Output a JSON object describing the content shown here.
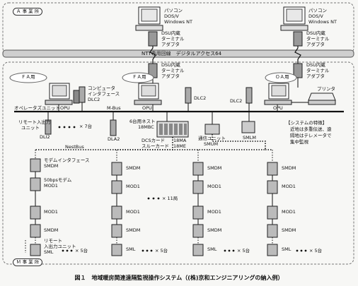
{
  "sites": {
    "a_office": "Ａ 事 業 所",
    "m_office": "Ｍ 事 業 所",
    "fa1": "ＦＡ用",
    "fa2": "ＦＡ用",
    "oa": "ＯＡ用"
  },
  "pc_labels": {
    "pc1": [
      "パソコン",
      "DOS/V",
      "Windows NT"
    ],
    "pc2": [
      "パソコン",
      "DOS/V",
      "Windows NT"
    ]
  },
  "dsu_labels": {
    "dsu1": [
      "DSU内蔵",
      "ターミナル",
      "アダプタ"
    ],
    "dsu2": [
      "DSU内蔵",
      "ターミナル",
      "アダプタ"
    ],
    "dsu3": [
      "DSU内蔵",
      "ターミナル",
      "アダプタ"
    ],
    "dsu4": [
      "DSU内蔵",
      "ターミナル",
      "アダプタ"
    ]
  },
  "ntt_line": "NTT専用回線　デジタルアクセス64",
  "devices": {
    "computer_interface": [
      "コンピュータ",
      "インタフェース",
      "DLC2"
    ],
    "operator_unit": "オペレータズユニットOPU",
    "m_bus": "M-Bus",
    "opu_1": "OPU",
    "dlc2_mid": "DLC2",
    "dlc2_right": "DLC2",
    "opu_2": "OPU",
    "printer": "プリンタ",
    "remote_io_top": [
      "リモート入出力",
      "ユニット"
    ],
    "dli2": "DLI2",
    "count_7": "× 7台",
    "dla2": "DLA2",
    "nest": [
      "6台用ネスト",
      "18MBC"
    ],
    "comm_unit": [
      "通信ユニット",
      "SMUM"
    ],
    "smlm": "SMLM",
    "dcs_card": [
      "DCSカード",
      "スルーカード"
    ],
    "dcs_models": [
      "18MA",
      "18ME"
    ],
    "nestbus": "NestBus"
  },
  "features": {
    "title": "【システムの特徴】",
    "lines": [
      "近地は多重伝送、遠",
      "隔地はテレメータで",
      "集中監視"
    ]
  },
  "remote_column": {
    "modem_if": [
      "モデムインタフェース",
      "SMDM"
    ],
    "modem_50bps": [
      "50bpsモデム",
      "MOD1"
    ],
    "mod1": "MOD1",
    "smdm": "SMDM",
    "remote_io": [
      "リモート",
      "入出力ユニット",
      "SML"
    ],
    "count_5": "× 5台"
  },
  "column_labels": {
    "smdm": "SMDM",
    "mod1": "MOD1",
    "sml": "SML",
    "count_5": "× 5台",
    "stations_11": "× 11局"
  },
  "caption": "図１　地域暖房関連遠隔監視操作システム（(株)京和エンジニアリングの納入例）"
}
